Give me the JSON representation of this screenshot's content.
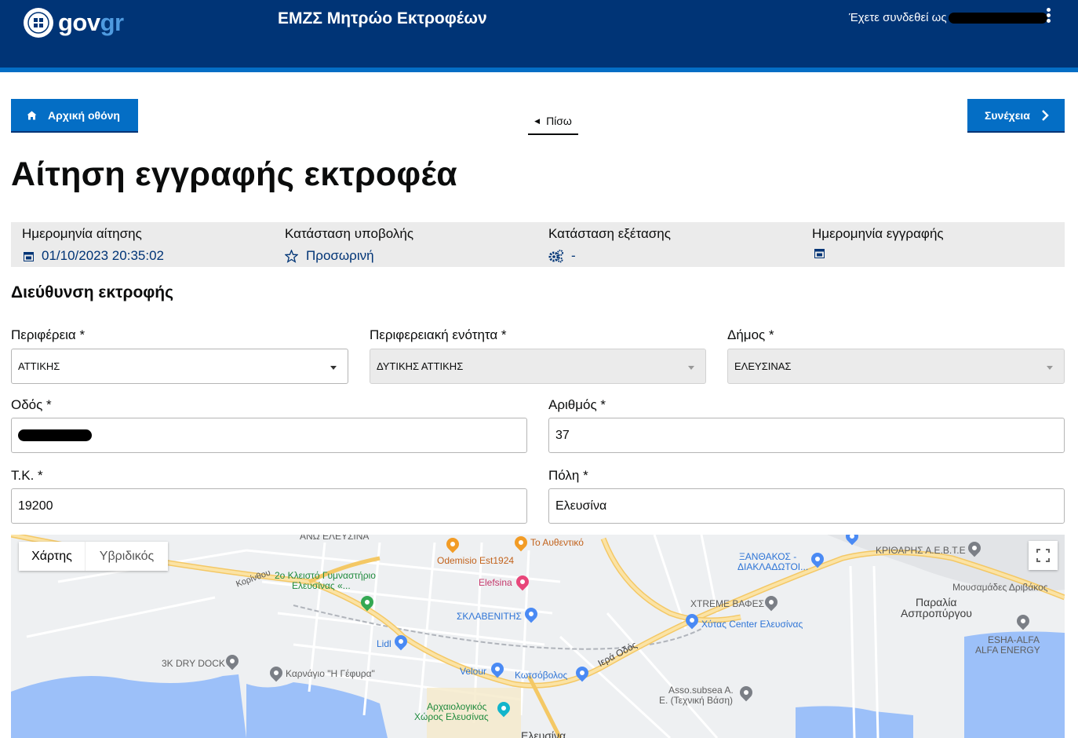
{
  "header": {
    "logo_main": "gov",
    "logo_accent": "gr",
    "app_title": "ΕΜΖΣ Μητρώο Εκτροφέων",
    "logged_in_label": "Έχετε συνδεθεί ως",
    "menu_icon": "kebab-menu-icon"
  },
  "nav": {
    "home_label": "Αρχική οθόνη",
    "back_label": "Πίσω",
    "next_label": "Συνέχεια"
  },
  "page_title": "Αίτηση εγγραφής εκτροφέα",
  "summary": {
    "application_date_label": "Ημερομηνία αίτησης",
    "application_date_value": "01/10/2023 20:35:02",
    "submission_status_label": "Κατάσταση υποβολής",
    "submission_status_value": "Προσωρινή",
    "review_status_label": "Κατάσταση εξέτασης",
    "review_status_value": "-",
    "registration_date_label": "Ημερομηνία εγγραφής",
    "registration_date_value": ""
  },
  "address_section": {
    "title": "Διεύθυνση εκτροφής",
    "region_label": "Περιφέρεια *",
    "region_value": "ΑΤΤΙΚΗΣ",
    "regional_unit_label": "Περιφερειακή ενότητα *",
    "regional_unit_value": "ΔΥΤΙΚΗΣ ΑΤΤΙΚΗΣ",
    "municipality_label": "Δήμος *",
    "municipality_value": "ΕΛΕΥΣΙΝΑΣ",
    "street_label": "Οδός *",
    "number_label": "Αριθμός *",
    "number_value": "37",
    "postal_code_label": "Τ.Κ. *",
    "postal_code_value": "19200",
    "city_label": "Πόλη *",
    "city_value": "Ελευσίνα"
  },
  "map": {
    "tab_map": "Χάρτης",
    "tab_hybrid": "Υβριδικός",
    "poi": {
      "ano_elefsina": "ΑΝΩ ΕΛΕΥΣΙΝΑ",
      "to_afthentiko": "Το Αυθεντικό",
      "odemisio": "Odemisio Est1924",
      "gymnasio": "2ο Κλειστό Γυμναστήριο",
      "gymnasio2": "Ελευσίνας «...",
      "elefsina_shop": "Elefsina",
      "sklavenitis": "ΣΚΛΑΒΕΝΙΤΗΣ",
      "lidl": "Lidl",
      "dry_dock": "3K DRY DOCK",
      "karnagio": "Καρνάγιο \"Η Γέφυρα\"",
      "velour": "Velour",
      "kotsovolos": "Κωτσόβολος",
      "archaeological": "Αρχαιολογικός",
      "archaeological2": "Χώρος Ελευσίνας",
      "xanthakos": "ΞΑΝΘΑΚΟΣ -",
      "xanthakos2": "ΔΙΑΚΛΑΔΩΤΟΙ...",
      "kriotharis": "ΚΡΙΘΑΡΗΣ Α.Ε.Β.Τ.Ε",
      "mousamades": "Μουσαμάδες Δριβάκος",
      "paralia": "Παραλία",
      "paralia2": "Ασπροπύργου",
      "xtreme": "XTREME ΒΑΦΕΣ",
      "xytas": "Χύτας Center Ελευσίνας",
      "esha": "ESHA-ALFA",
      "esha2": "ALFA ENERGY",
      "asso": "Asso.subsea A.",
      "asso2": "E. (Τεχνική Βάση)",
      "iera_odos": "Ιερά Οδός",
      "korinthou": "Κορίνθου",
      "elefsina_bottom": "Ελευσίνα"
    }
  },
  "colors": {
    "header_bg": "#003476",
    "stripe": "#046ec5",
    "button": "#046ec5",
    "value_text": "#003476"
  }
}
